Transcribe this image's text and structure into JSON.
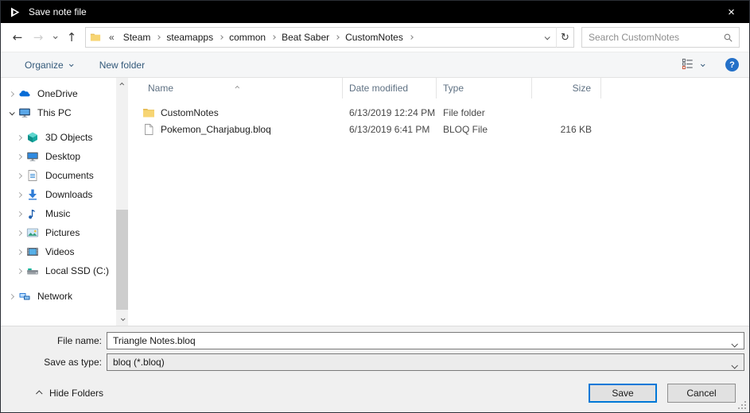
{
  "window": {
    "title": "Save note file",
    "close_glyph": "×"
  },
  "nav": {
    "back_glyph": "←",
    "forward_glyph": "→",
    "up_glyph": "↑",
    "refresh_glyph": "↻",
    "address_overflow": "«",
    "breadcrumbs": [
      "Steam",
      "steamapps",
      "common",
      "Beat Saber",
      "CustomNotes"
    ],
    "search_placeholder": "Search CustomNotes"
  },
  "toolbar": {
    "organize": "Organize",
    "new_folder": "New folder",
    "help_glyph": "?"
  },
  "sidebar": {
    "items": [
      {
        "label": "OneDrive",
        "icon": "onedrive-icon",
        "level": 0,
        "expanded": false,
        "gap": 0
      },
      {
        "label": "This PC",
        "icon": "this-pc-icon",
        "level": 0,
        "expanded": true,
        "gap": 0
      },
      {
        "label": "3D Objects",
        "icon": "3d-objects-icon",
        "level": 1,
        "expanded": false,
        "gap": 7
      },
      {
        "label": "Desktop",
        "icon": "desktop-icon",
        "level": 1,
        "expanded": false,
        "gap": 0
      },
      {
        "label": "Documents",
        "icon": "documents-icon",
        "level": 1,
        "expanded": false,
        "gap": 0
      },
      {
        "label": "Downloads",
        "icon": "downloads-icon",
        "level": 1,
        "expanded": false,
        "gap": 0
      },
      {
        "label": "Music",
        "icon": "music-icon",
        "level": 1,
        "expanded": false,
        "gap": 0
      },
      {
        "label": "Pictures",
        "icon": "pictures-icon",
        "level": 1,
        "expanded": false,
        "gap": 0
      },
      {
        "label": "Videos",
        "icon": "videos-icon",
        "level": 1,
        "expanded": false,
        "gap": 0
      },
      {
        "label": "Local SSD (C:)",
        "icon": "drive-icon",
        "level": 1,
        "expanded": false,
        "gap": 0
      },
      {
        "label": "Network",
        "icon": "network-icon",
        "level": 0,
        "expanded": false,
        "gap": 8
      }
    ]
  },
  "filelist": {
    "columns": [
      "Name",
      "Date modified",
      "Type",
      "Size"
    ],
    "sorted_column": "Name",
    "rows": [
      {
        "name": "CustomNotes",
        "date": "6/13/2019 12:24 PM",
        "type": "File folder",
        "size": "",
        "icon": "folder-icon"
      },
      {
        "name": "Pokemon_Charjabug.bloq",
        "date": "6/13/2019 6:41 PM",
        "type": "BLOQ File",
        "size": "216 KB",
        "icon": "bloq-file-icon"
      }
    ]
  },
  "fields": {
    "file_name_label": "File name:",
    "file_name_value": "Triangle Notes.bloq",
    "save_as_type_label": "Save as type:",
    "save_as_type_value": "bloq (*.bloq)"
  },
  "footer": {
    "hide_folders": "Hide Folders",
    "save": "Save",
    "cancel": "Cancel"
  },
  "colors": {
    "accent": "#0078d7",
    "titlebar": "#000000",
    "help_blue": "#2470c8",
    "folder_yellow": "#f7d573"
  }
}
